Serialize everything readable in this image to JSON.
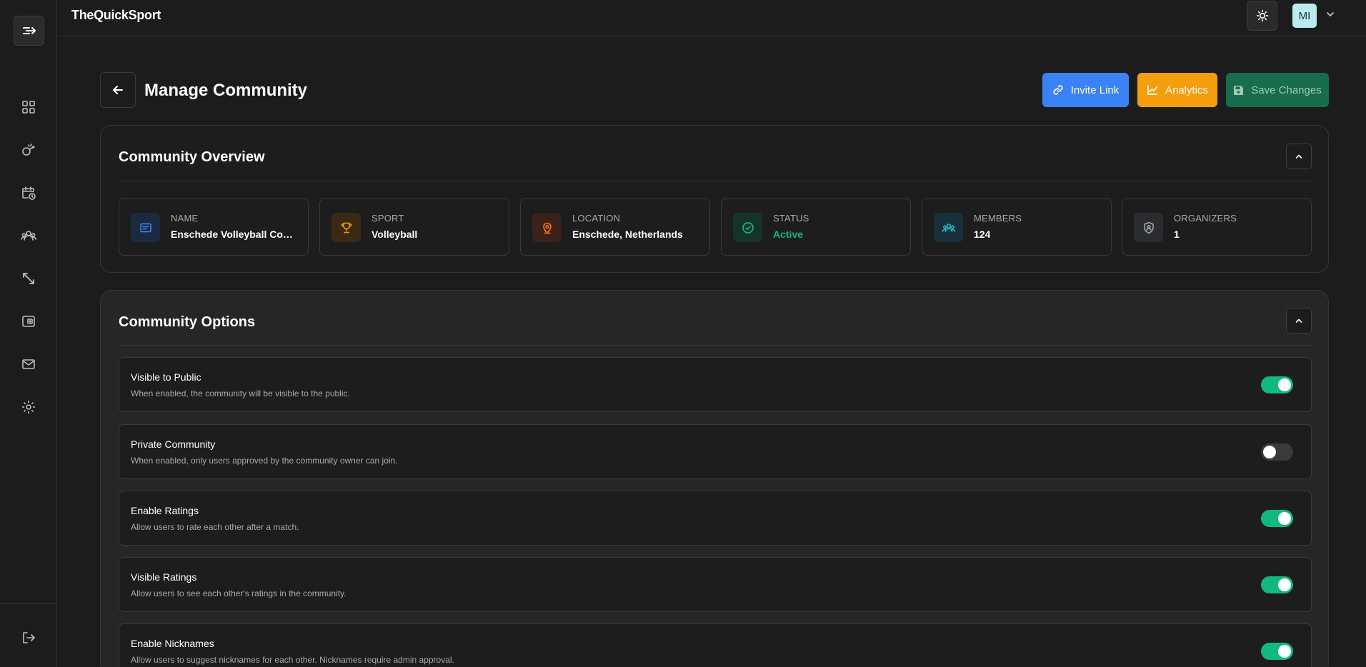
{
  "app": {
    "logo": "TheQuickSport"
  },
  "header": {
    "avatar_initials": "MI"
  },
  "page": {
    "title": "Manage Community"
  },
  "actions": {
    "invite_label": "Invite Link",
    "analytics_label": "Analytics",
    "save_label": "Save Changes",
    "colors": {
      "invite": "#3b82f6",
      "analytics": "#f59e0b",
      "save": "#176d4c"
    }
  },
  "sidebar": {
    "items": [
      {
        "icon": "dashboard-grid-icon"
      },
      {
        "icon": "sport-whistle-icon"
      },
      {
        "icon": "calendar-clock-icon"
      },
      {
        "icon": "community-users-icon"
      },
      {
        "icon": "resize-arrows-icon"
      },
      {
        "icon": "wallet-icon"
      },
      {
        "icon": "mail-icon"
      },
      {
        "icon": "settings-gear-icon"
      }
    ]
  },
  "overview": {
    "title": "Community Overview",
    "stats": [
      {
        "label": "NAME",
        "value": "Enschede Volleyball Com...",
        "icon": "card-text-icon",
        "color": "#3b82f6"
      },
      {
        "label": "SPORT",
        "value": "Volleyball",
        "icon": "trophy-icon",
        "color": "#f59e0b"
      },
      {
        "label": "LOCATION",
        "value": "Enschede, Netherlands",
        "icon": "map-pin-icon",
        "color": "#f97316"
      },
      {
        "label": "STATUS",
        "value": "Active",
        "icon": "check-circle-icon",
        "color": "#10b981",
        "value_color": "#10b981"
      },
      {
        "label": "MEMBERS",
        "value": "124",
        "icon": "members-icon",
        "color": "#22b8cf"
      },
      {
        "label": "ORGANIZERS",
        "value": "1",
        "icon": "shield-user-icon",
        "color": "#9ca3af"
      }
    ]
  },
  "options": {
    "title": "Community Options",
    "items": [
      {
        "title": "Visible to Public",
        "description": "When enabled, the community will be visible to the public.",
        "enabled": true
      },
      {
        "title": "Private Community",
        "description": "When enabled, only users approved by the community owner can join.",
        "enabled": false
      },
      {
        "title": "Enable Ratings",
        "description": "Allow users to rate each other after a match.",
        "enabled": true
      },
      {
        "title": "Visible Ratings",
        "description": "Allow users to see each other's ratings in the community.",
        "enabled": true
      },
      {
        "title": "Enable Nicknames",
        "description": "Allow users to suggest nicknames for each other. Nicknames require admin approval.",
        "enabled": true
      }
    ]
  }
}
